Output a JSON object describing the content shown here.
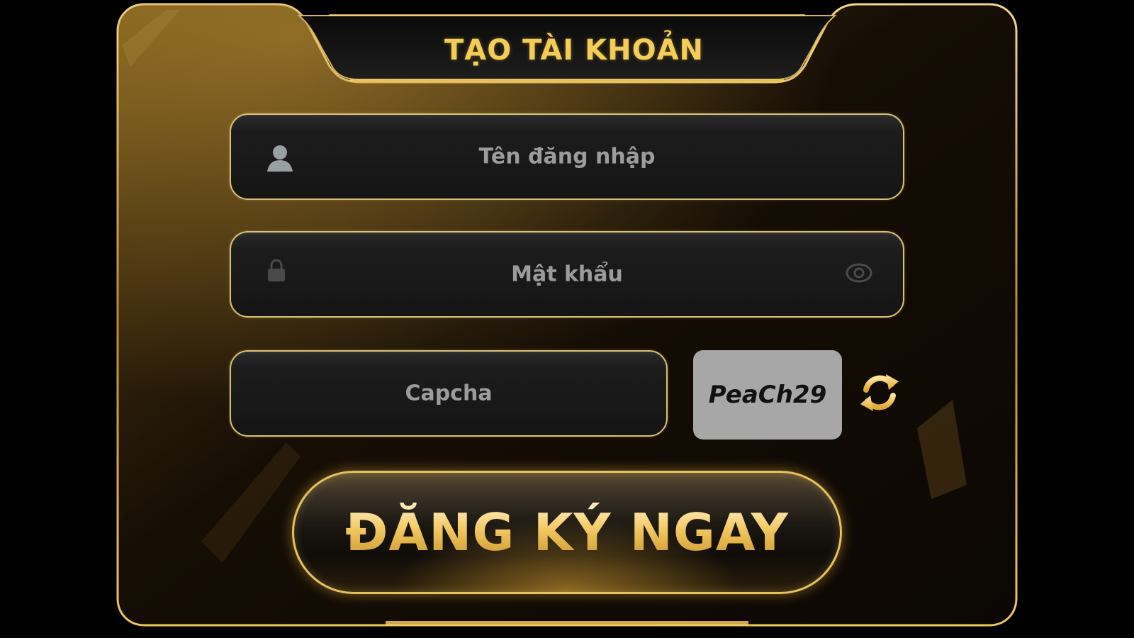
{
  "dialog": {
    "title": "TẠO TÀI KHOẢN"
  },
  "form": {
    "username": {
      "placeholder": "Tên đăng nhập",
      "value": ""
    },
    "password": {
      "placeholder": "Mật khẩu",
      "value": ""
    },
    "captcha": {
      "placeholder": "Capcha",
      "value": ""
    },
    "captcha_code": "PeaCh29",
    "submit_label": "ĐĂNG KÝ NGAY"
  },
  "icons": {
    "username": "user-icon",
    "password": "lock-icon",
    "password_toggle": "eye-icon",
    "captcha_refresh": "refresh-icon"
  },
  "colors": {
    "accent_gold": "#f3cd55",
    "border_gold": "#d9c278",
    "panel_bg": "#1a1208",
    "captcha_bg": "#a7a7a7",
    "placeholder_text": "#9c9c9c"
  }
}
